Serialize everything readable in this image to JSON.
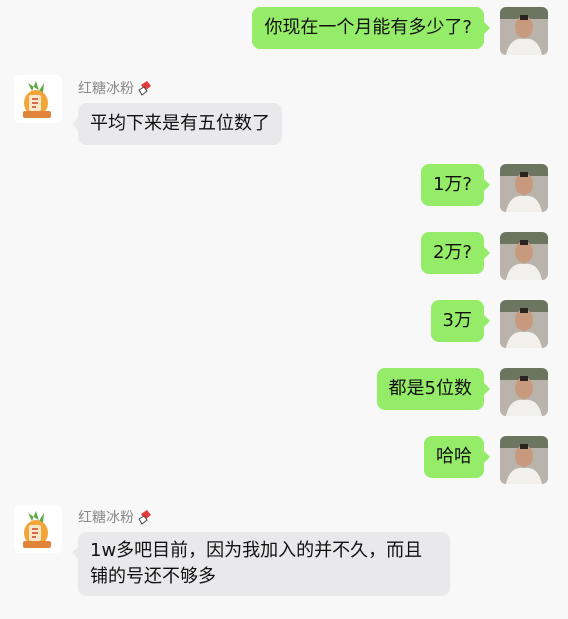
{
  "conversation": {
    "messages": [
      {
        "side": "me",
        "text": "你现在一个月能有多少了?"
      },
      {
        "side": "other",
        "sender": "红糖冰粉",
        "text": "平均下来是有五位数了"
      },
      {
        "side": "me",
        "text": "1万?"
      },
      {
        "side": "me",
        "text": "2万?"
      },
      {
        "side": "me",
        "text": "3万"
      },
      {
        "side": "me",
        "text": "都是5位数"
      },
      {
        "side": "me",
        "text": "哈哈"
      },
      {
        "side": "other",
        "sender": "红糖冰粉",
        "text_line1": "1w多吧目前，因为我加入的并不久，而且",
        "text_line2": "铺的号还不够多"
      }
    ]
  },
  "colors": {
    "my_bubble": "#95ec69",
    "other_bubble": "#e9e9eb",
    "background": "#f8f8f8",
    "sender_name": "#8a8a8a"
  },
  "icons": {
    "sender_badge": "red-plaster-badge-icon",
    "other_avatar": "cartoon-pineapple-avatar",
    "my_avatar": "person-photo-avatar"
  }
}
